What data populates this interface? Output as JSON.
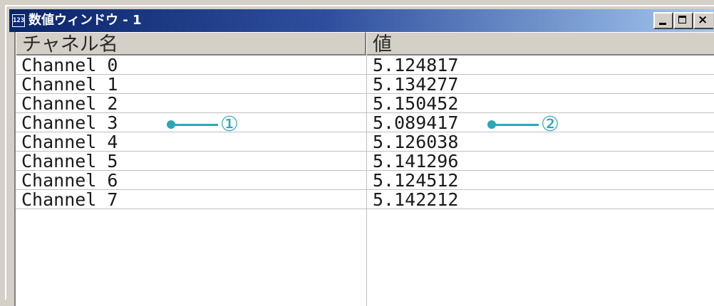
{
  "window": {
    "icon_label": "123",
    "title": "数値ウィンドウ - 1",
    "buttons": {
      "minimize_icon": "minimize-icon",
      "maximize_icon": "maximize-icon",
      "close_glyph": "×"
    }
  },
  "table": {
    "columns": [
      "チャネル名",
      "値"
    ],
    "rows": [
      {
        "name": "Channel 0",
        "value": "5.124817"
      },
      {
        "name": "Channel 1",
        "value": "5.134277"
      },
      {
        "name": "Channel 2",
        "value": "5.150452"
      },
      {
        "name": "Channel 3",
        "value": "5.089417"
      },
      {
        "name": "Channel 4",
        "value": "5.126038"
      },
      {
        "name": "Channel 5",
        "value": "5.141296"
      },
      {
        "name": "Channel 6",
        "value": "5.124512"
      },
      {
        "name": "Channel 7",
        "value": "5.142212"
      }
    ]
  },
  "callouts": [
    {
      "label": "①",
      "target": "Channel 3"
    },
    {
      "label": "②",
      "target": "5.089417"
    }
  ],
  "colors": {
    "titlebar_start": "#0a246a",
    "titlebar_end": "#a6caf0",
    "callout": "#2aa8b8",
    "chrome": "#d4d0c8"
  }
}
